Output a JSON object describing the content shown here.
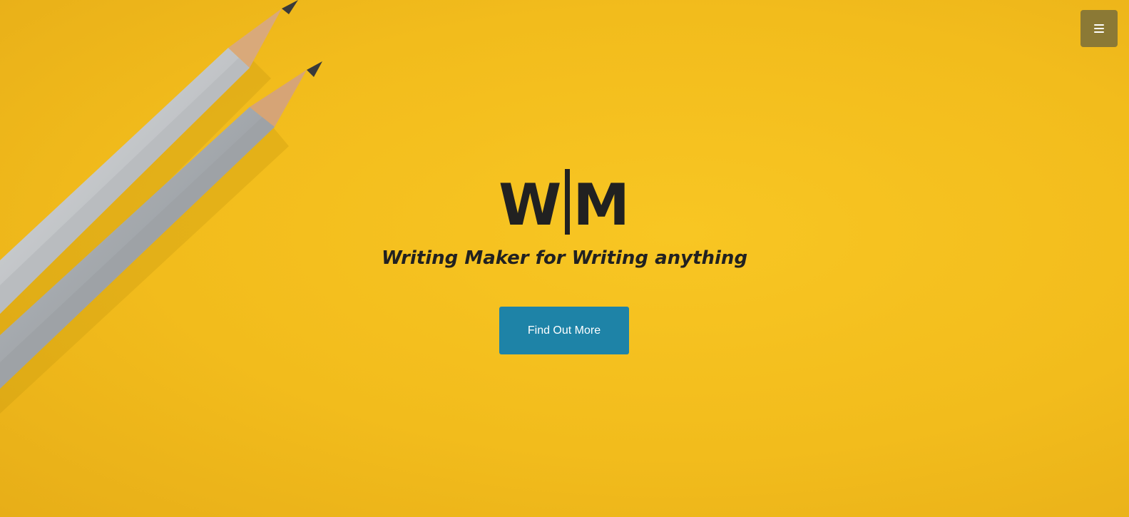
{
  "header": {
    "menu_icon": "hamburger-menu-icon"
  },
  "hero": {
    "logo_left": "W",
    "logo_right": "M",
    "tagline": "Writing Maker for Writing anything",
    "cta_label": "Find Out More",
    "background_color": "#f5c11f",
    "cta_color": "#1e83a7",
    "menu_button_color": "#8b7935"
  }
}
